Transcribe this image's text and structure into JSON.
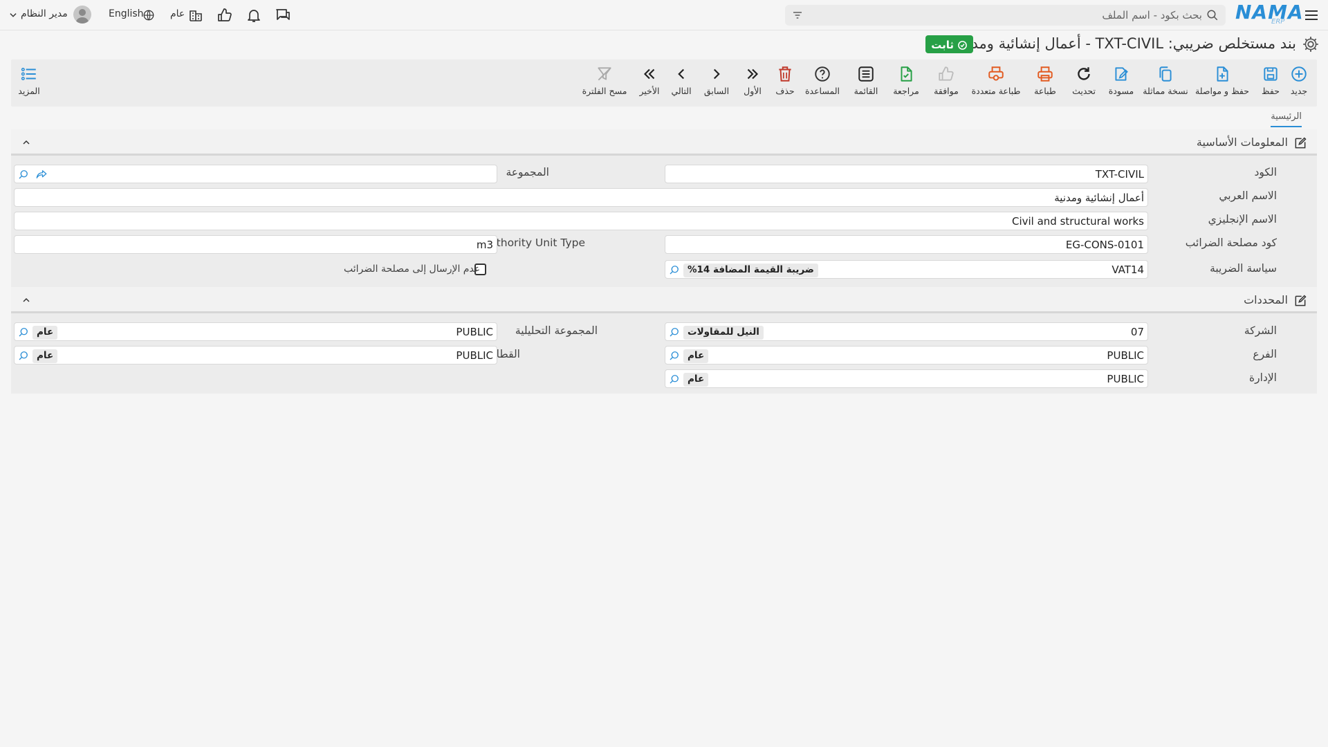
{
  "topbar": {
    "logo": "NAMA",
    "logo_sub": "ERP",
    "search_placeholder": "بحث بكود - اسم الملف",
    "company_label": "عام",
    "language_label": "English",
    "user_name": "مدير النظام"
  },
  "title": {
    "text": "بند مستخلص ضريبي: TXT-CIVIL - أعمال إنشائية ومدنية",
    "status_badge": "ثابت",
    "status_color": "#27a046"
  },
  "toolbar": {
    "new": "جديد",
    "save": "حفظ",
    "save_continue": "حفظ و مواصلة",
    "duplicate": "نسخة مماثلة",
    "draft": "مسودة",
    "refresh": "تحديث",
    "print": "طباعة",
    "multi_print": "طباعة متعددة",
    "approve": "موافقة",
    "review": "مراجعة",
    "list": "القائمة",
    "help": "المساعدة",
    "delete": "حذف",
    "first": "الأول",
    "previous": "السابق",
    "next": "التالي",
    "last": "الأخير",
    "clear_filter": "مسح الفلترة",
    "more": "المزيد"
  },
  "tabs": [
    {
      "label": "الرئيسية",
      "active": true
    }
  ],
  "basic_info": {
    "title": "المعلومات الأساسية",
    "code_label": "الكود",
    "code_value": "TXT-CIVIL",
    "group_label": "المجموعة",
    "group_value": "",
    "arabic_name_label": "الاسم العربي",
    "arabic_name_value": "أعمال إنشائية ومدنية",
    "english_name_label": "الاسم الإنجليزي",
    "english_name_value": "Civil and structural works",
    "tax_code_label": "كود مصلحة الضرائب",
    "tax_code_value": "EG-CONS-0101",
    "unit_type_label": "Tax Authority Unit Type",
    "unit_type_value": "m3",
    "tax_policy_label": "سياسة الضريبة",
    "tax_policy_value": "VAT14",
    "tax_policy_tag": "ضريبة القيمة المضافة 14%",
    "no_send_label": "عدم الإرسال إلى مصلحة الضرائب",
    "no_send_checked": false
  },
  "dimensions": {
    "title": "المحددات",
    "company_label": "الشركة",
    "company_value": "07",
    "company_tag": "النيل للمقاولات",
    "analytic_group_label": "المجموعة التحليلية",
    "analytic_group_value": "PUBLIC",
    "analytic_group_tag": "عام",
    "branch_label": "الفرع",
    "branch_value": "PUBLIC",
    "branch_tag": "عام",
    "sector_label": "القطاع",
    "sector_value": "PUBLIC",
    "sector_tag": "عام",
    "department_label": "الإدارة",
    "department_value": "PUBLIC",
    "department_tag": "عام"
  }
}
